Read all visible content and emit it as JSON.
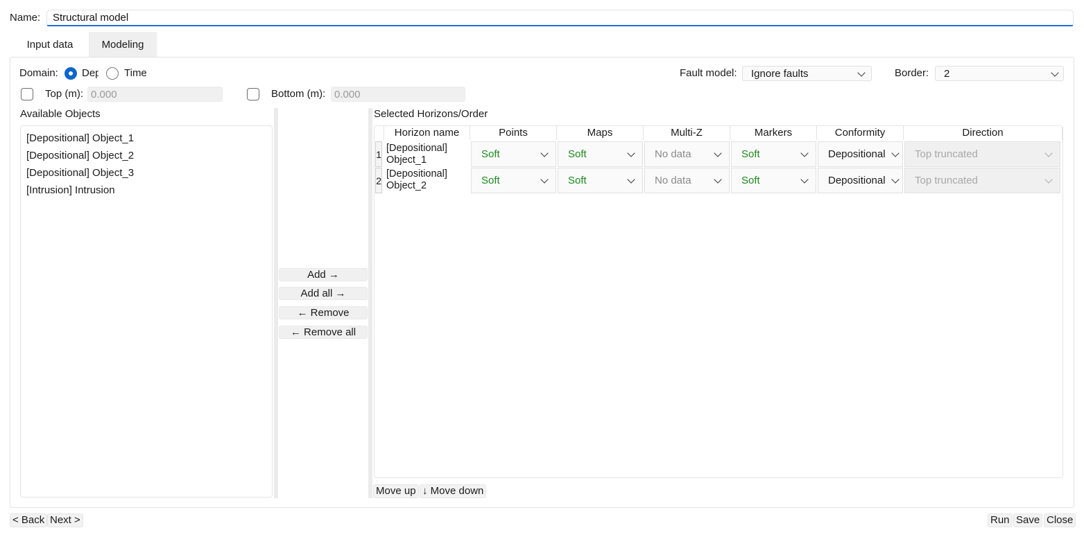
{
  "name": {
    "label": "Name:",
    "value": "Structural model"
  },
  "tabs": [
    {
      "label": "Input data"
    },
    {
      "label": "Modeling"
    }
  ],
  "domain": {
    "label": "Domain:",
    "options": [
      {
        "label": "Dep",
        "selected": true
      },
      {
        "label": "Time",
        "selected": false
      }
    ]
  },
  "fault_model": {
    "label": "Fault model:",
    "value": "Ignore faults"
  },
  "border": {
    "label": "Border:",
    "value": "2"
  },
  "top": {
    "label": "Top (m):",
    "placeholder": "0.000"
  },
  "bottom": {
    "label": "Bottom (m):",
    "placeholder": "0.000"
  },
  "available": {
    "title": "Available Objects",
    "items": [
      "[Depositional] Object_1",
      "[Depositional] Object_2",
      "[Depositional] Object_3",
      "[Intrusion] Intrusion"
    ]
  },
  "mid_buttons": {
    "add": "Add →",
    "add_all": "Add all →",
    "remove": "← Remove",
    "remove_all": "← Remove all"
  },
  "selected": {
    "title": "Selected Horizons/Order",
    "columns": [
      "Horizon name",
      "Points",
      "Maps",
      "Multi-Z",
      "Markers",
      "Conformity",
      "Direction"
    ],
    "rows": [
      {
        "num": "1",
        "name1": "[Depositional]",
        "name2": "Object_1",
        "points": "Soft",
        "maps": "Soft",
        "multiz": "No data",
        "markers": "Soft",
        "conformity": "Depositional",
        "direction": "Top truncated"
      },
      {
        "num": "2",
        "name1": "[Depositional]",
        "name2": "Object_2",
        "points": "Soft",
        "maps": "Soft",
        "multiz": "No data",
        "markers": "Soft",
        "conformity": "Depositional",
        "direction": "Top truncated"
      }
    ]
  },
  "move": {
    "up": "Move up",
    "down": "↓ Move down"
  },
  "footer": {
    "back": "< Back",
    "next": "Next >",
    "run": "Run",
    "save": "Save",
    "close": "Close"
  },
  "colors": {
    "accent": "#0a67c9",
    "green_text": "#1e8a1e"
  }
}
